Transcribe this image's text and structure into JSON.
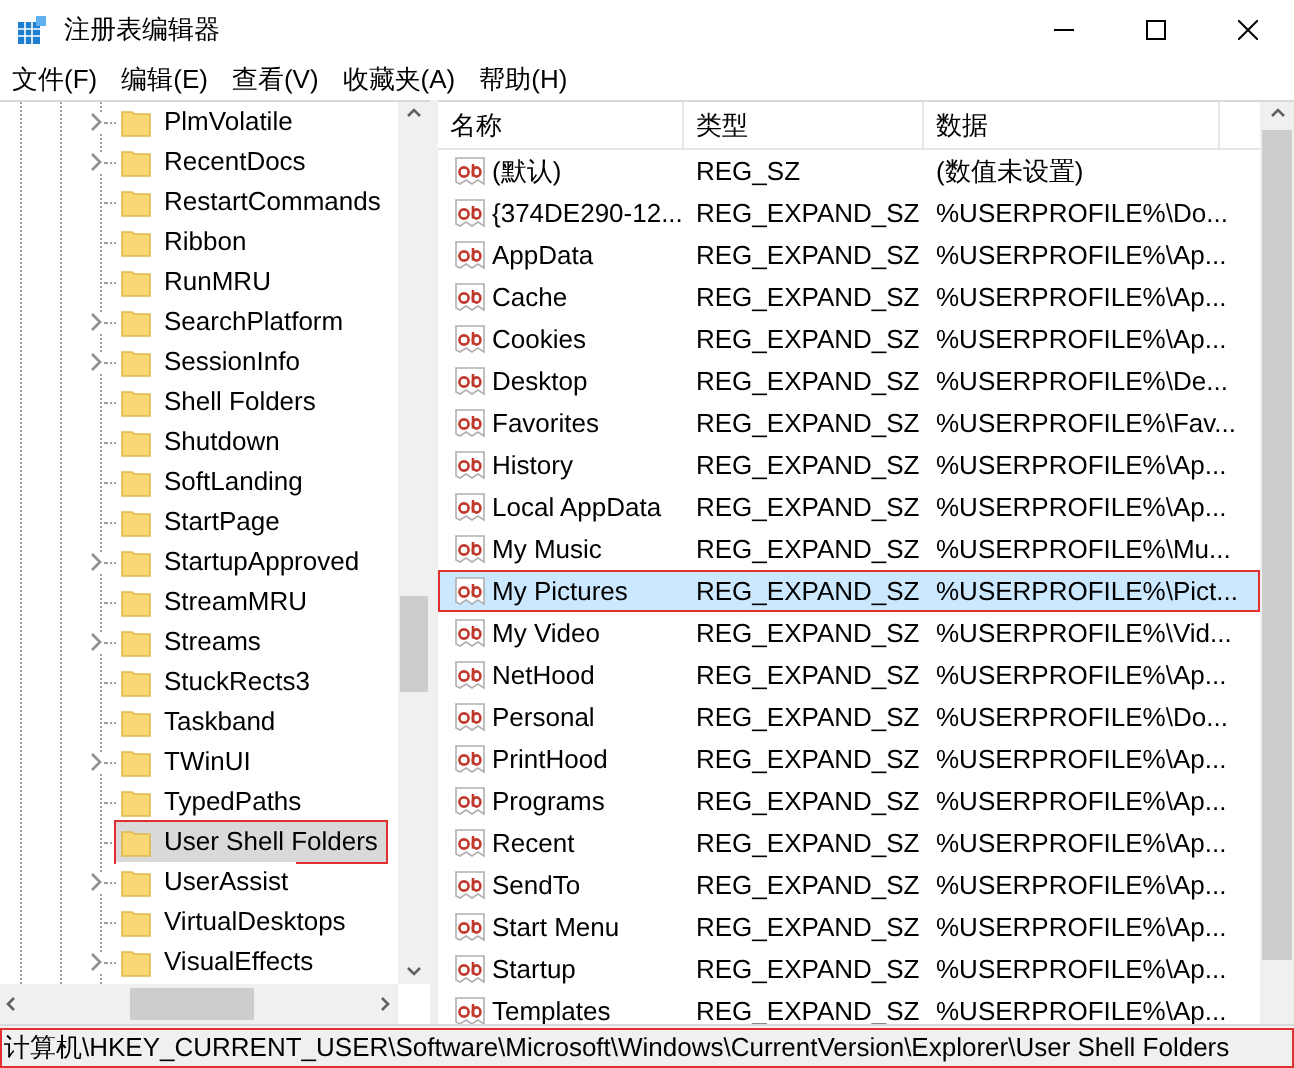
{
  "window": {
    "title": "注册表编辑器"
  },
  "menu": [
    "文件(F)",
    "编辑(E)",
    "查看(V)",
    "收藏夹(A)",
    "帮助(H)"
  ],
  "tree": [
    {
      "label": "PlmVolatile",
      "expandable": true,
      "selected": false
    },
    {
      "label": "RecentDocs",
      "expandable": true,
      "selected": false
    },
    {
      "label": "RestartCommands",
      "expandable": false,
      "selected": false
    },
    {
      "label": "Ribbon",
      "expandable": false,
      "selected": false
    },
    {
      "label": "RunMRU",
      "expandable": false,
      "selected": false
    },
    {
      "label": "SearchPlatform",
      "expandable": true,
      "selected": false
    },
    {
      "label": "SessionInfo",
      "expandable": true,
      "selected": false
    },
    {
      "label": "Shell Folders",
      "expandable": false,
      "selected": false
    },
    {
      "label": "Shutdown",
      "expandable": false,
      "selected": false
    },
    {
      "label": "SoftLanding",
      "expandable": false,
      "selected": false
    },
    {
      "label": "StartPage",
      "expandable": false,
      "selected": false
    },
    {
      "label": "StartupApproved",
      "expandable": true,
      "selected": false
    },
    {
      "label": "StreamMRU",
      "expandable": false,
      "selected": false
    },
    {
      "label": "Streams",
      "expandable": true,
      "selected": false
    },
    {
      "label": "StuckRects3",
      "expandable": false,
      "selected": false
    },
    {
      "label": "Taskband",
      "expandable": false,
      "selected": false
    },
    {
      "label": "TWinUI",
      "expandable": true,
      "selected": false
    },
    {
      "label": "TypedPaths",
      "expandable": false,
      "selected": false
    },
    {
      "label": "User Shell Folders",
      "expandable": false,
      "selected": true
    },
    {
      "label": "UserAssist",
      "expandable": true,
      "selected": false
    },
    {
      "label": "VirtualDesktops",
      "expandable": false,
      "selected": false
    },
    {
      "label": "VisualEffects",
      "expandable": true,
      "selected": false
    }
  ],
  "table": {
    "columns": [
      "名称",
      "类型",
      "数据"
    ],
    "rows": [
      {
        "name": "(默认)",
        "type": "REG_SZ",
        "data": "(数值未设置)",
        "selected": false
      },
      {
        "name": "{374DE290-12...",
        "type": "REG_EXPAND_SZ",
        "data": "%USERPROFILE%\\Do...",
        "selected": false
      },
      {
        "name": "AppData",
        "type": "REG_EXPAND_SZ",
        "data": "%USERPROFILE%\\Ap...",
        "selected": false
      },
      {
        "name": "Cache",
        "type": "REG_EXPAND_SZ",
        "data": "%USERPROFILE%\\Ap...",
        "selected": false
      },
      {
        "name": "Cookies",
        "type": "REG_EXPAND_SZ",
        "data": "%USERPROFILE%\\Ap...",
        "selected": false
      },
      {
        "name": "Desktop",
        "type": "REG_EXPAND_SZ",
        "data": "%USERPROFILE%\\De...",
        "selected": false
      },
      {
        "name": "Favorites",
        "type": "REG_EXPAND_SZ",
        "data": "%USERPROFILE%\\Fav...",
        "selected": false
      },
      {
        "name": "History",
        "type": "REG_EXPAND_SZ",
        "data": "%USERPROFILE%\\Ap...",
        "selected": false
      },
      {
        "name": "Local AppData",
        "type": "REG_EXPAND_SZ",
        "data": "%USERPROFILE%\\Ap...",
        "selected": false
      },
      {
        "name": "My Music",
        "type": "REG_EXPAND_SZ",
        "data": "%USERPROFILE%\\Mu...",
        "selected": false
      },
      {
        "name": "My Pictures",
        "type": "REG_EXPAND_SZ",
        "data": "%USERPROFILE%\\Pict...",
        "selected": true
      },
      {
        "name": "My Video",
        "type": "REG_EXPAND_SZ",
        "data": "%USERPROFILE%\\Vid...",
        "selected": false
      },
      {
        "name": "NetHood",
        "type": "REG_EXPAND_SZ",
        "data": "%USERPROFILE%\\Ap...",
        "selected": false
      },
      {
        "name": "Personal",
        "type": "REG_EXPAND_SZ",
        "data": "%USERPROFILE%\\Do...",
        "selected": false
      },
      {
        "name": "PrintHood",
        "type": "REG_EXPAND_SZ",
        "data": "%USERPROFILE%\\Ap...",
        "selected": false
      },
      {
        "name": "Programs",
        "type": "REG_EXPAND_SZ",
        "data": "%USERPROFILE%\\Ap...",
        "selected": false
      },
      {
        "name": "Recent",
        "type": "REG_EXPAND_SZ",
        "data": "%USERPROFILE%\\Ap...",
        "selected": false
      },
      {
        "name": "SendTo",
        "type": "REG_EXPAND_SZ",
        "data": "%USERPROFILE%\\Ap...",
        "selected": false
      },
      {
        "name": "Start Menu",
        "type": "REG_EXPAND_SZ",
        "data": "%USERPROFILE%\\Ap...",
        "selected": false
      },
      {
        "name": "Startup",
        "type": "REG_EXPAND_SZ",
        "data": "%USERPROFILE%\\Ap...",
        "selected": false
      },
      {
        "name": "Templates",
        "type": "REG_EXPAND_SZ",
        "data": "%USERPROFILE%\\Ap...",
        "selected": false
      }
    ]
  },
  "status_bar": "计算机\\HKEY_CURRENT_USER\\Software\\Microsoft\\Windows\\CurrentVersion\\Explorer\\User Shell Folders"
}
